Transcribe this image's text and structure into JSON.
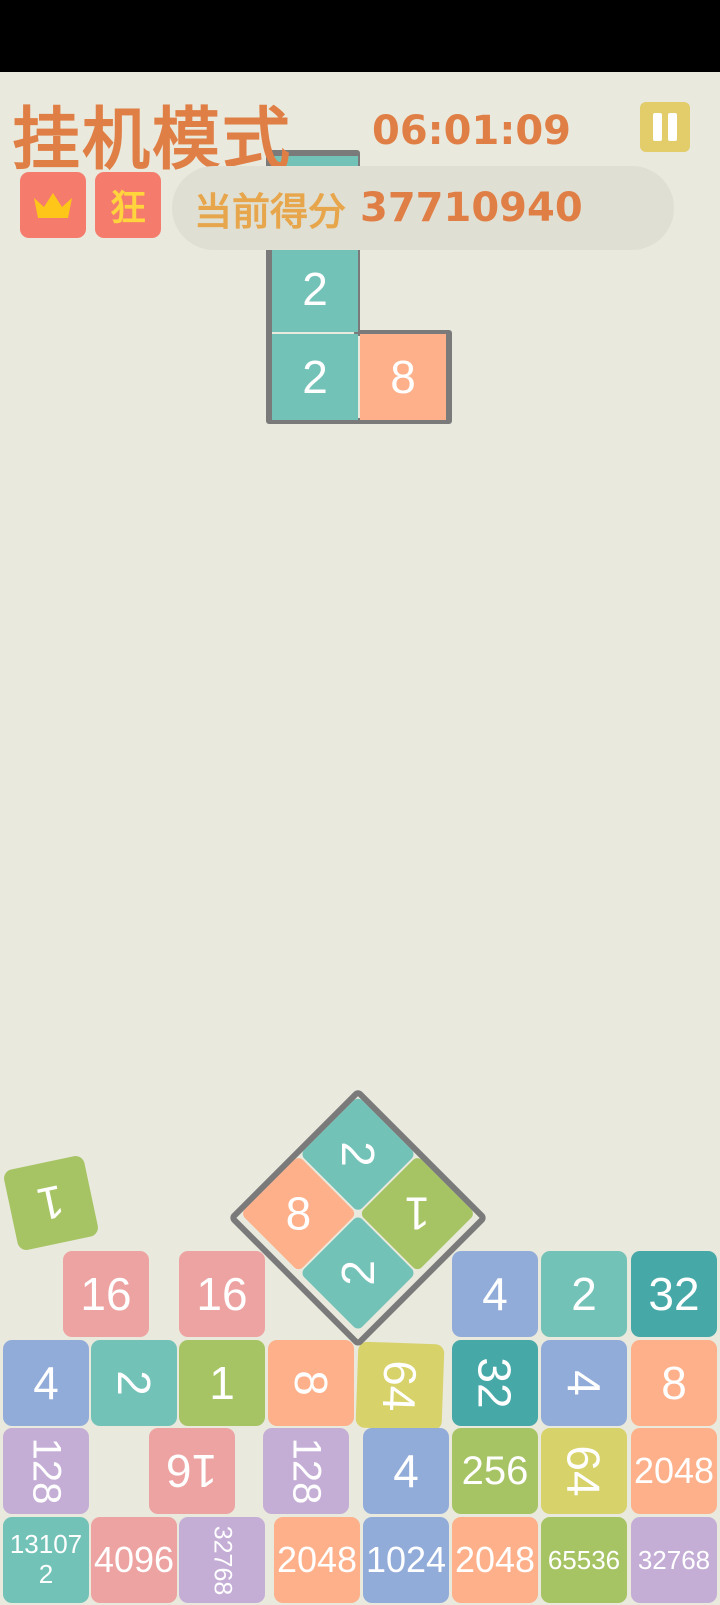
{
  "header": {
    "mode_title": "挂机模式",
    "timer": "06:01:09",
    "badge_kuang": "狂",
    "score_label": "当前得分",
    "score_value": "37710940",
    "icons": [
      "crown-icon",
      "pause-icon"
    ]
  },
  "falling_piece": {
    "top": "",
    "middle": "2",
    "bottom_left": "2",
    "bottom_right": "8"
  },
  "diamond_piece": {
    "top": "2",
    "right": "1",
    "bottom": "2",
    "left": "8"
  },
  "loose_tile": "1",
  "board": {
    "row0": [
      "16",
      "16",
      "4",
      "2",
      "32"
    ],
    "row1": [
      "4",
      "2",
      "1",
      "8",
      "64",
      "32",
      "4",
      "8"
    ],
    "row2": [
      "128",
      "16",
      "128",
      "4",
      "256",
      "64",
      "2048"
    ],
    "row3": [
      "131072",
      "4096",
      "32768",
      "2048",
      "1024",
      "2048",
      "65536",
      "32768"
    ]
  },
  "colors": {
    "background": "#e9e9dd",
    "title": "#e07f45",
    "pause": "#e3cc6a",
    "badge": "#f57c6c",
    "teal": "#73c2b8",
    "dark_teal": "#47a8a8",
    "green": "#a7c464",
    "pink": "#eda3a1",
    "orange": "#feb08a",
    "blue": "#92acda",
    "purple": "#c5aed6",
    "yellow": "#d7d26a"
  }
}
